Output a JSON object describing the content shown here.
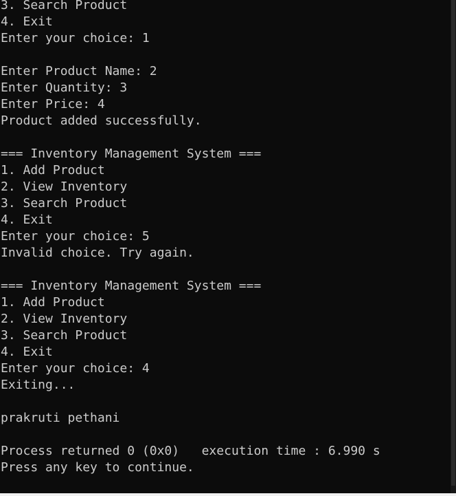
{
  "console": {
    "lines": [
      "3. Search Product",
      "4. Exit",
      "Enter your choice: 1",
      "",
      "Enter Product Name: 2",
      "Enter Quantity: 3",
      "Enter Price: 4",
      "Product added successfully.",
      "",
      "=== Inventory Management System ===",
      "1. Add Product",
      "2. View Inventory",
      "3. Search Product",
      "4. Exit",
      "Enter your choice: 5",
      "Invalid choice. Try again.",
      "",
      "=== Inventory Management System ===",
      "1. Add Product",
      "2. View Inventory",
      "3. Search Product",
      "4. Exit",
      "Enter your choice: 4",
      "Exiting...",
      "",
      "prakruti pethani",
      "",
      "Process returned 0 (0x0)   execution time : 6.990 s",
      "Press any key to continue."
    ]
  },
  "colors": {
    "background": "#0c0c0c",
    "text": "#cccccc"
  }
}
